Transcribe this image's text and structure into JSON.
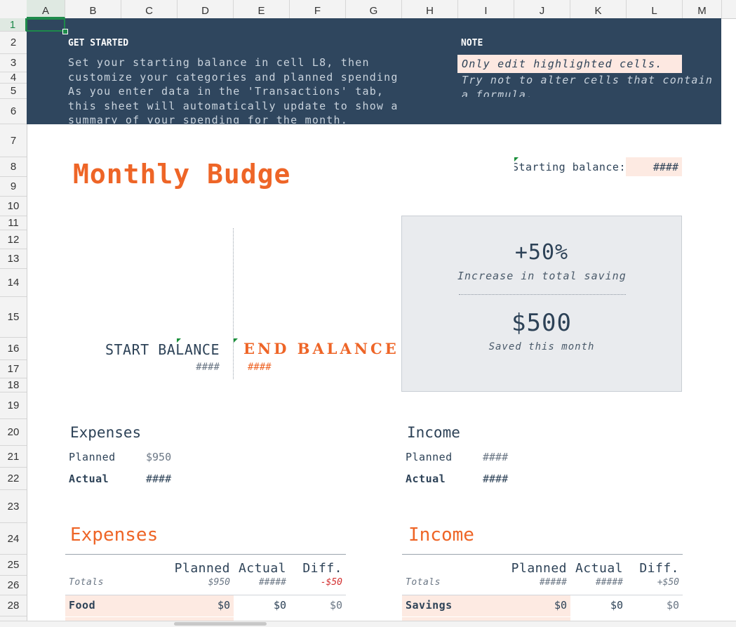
{
  "columns": [
    "A",
    "B",
    "C",
    "D",
    "E",
    "F",
    "G",
    "H",
    "I",
    "J",
    "K",
    "L",
    "M"
  ],
  "rows": [
    "1",
    "2",
    "3",
    "4",
    "5",
    "6",
    "7",
    "8",
    "9",
    "10",
    "11",
    "12",
    "13",
    "14",
    "15",
    "16",
    "17",
    "18",
    "19",
    "20",
    "21",
    "22",
    "23",
    "24",
    "25",
    "26",
    "28"
  ],
  "banner": {
    "get_started_title": "GET STARTED",
    "get_started_lines": [
      "Set your starting balance in cell L8, then",
      "customize your categories and planned spending",
      "As you enter data in the 'Transactions' tab,",
      "this sheet will automatically update to show a",
      "summary of your spending for the month."
    ],
    "note_title": "NOTE",
    "note_line1": "Only edit highlighted cells.",
    "note_line2": "Try not to alter cells that contain",
    "note_line3": "a formula."
  },
  "sheet_title": "Monthly Budget",
  "starting_balance_label": "Starting balance:",
  "starting_balance_value": "####",
  "start_balance_label": "START BALANCE",
  "start_balance_value": "####",
  "end_balance_label": "END BALANCE",
  "end_balance_value": "####",
  "stats": {
    "percent": "+50%",
    "percent_caption": "Increase in total savings",
    "saved": "$500",
    "saved_caption": "Saved this month"
  },
  "summary": {
    "expenses_title": "Expenses",
    "income_title": "Income",
    "planned_label": "Planned",
    "actual_label": "Actual",
    "expenses_planned": "$950",
    "expenses_actual": "####",
    "income_planned": "####",
    "income_actual": "####"
  },
  "expenses_table": {
    "title": "Expenses",
    "headers": [
      "Planned",
      "Actual",
      "Diff."
    ],
    "totals_label": "Totals",
    "totals": [
      "$950",
      "#####",
      "-$50"
    ],
    "rows": [
      {
        "name": "Food",
        "values": [
          "$0",
          "$0",
          "$0"
        ]
      }
    ]
  },
  "income_table": {
    "title": "Income",
    "headers": [
      "Planned",
      "Actual",
      "Diff."
    ],
    "totals_label": "Totals",
    "totals": [
      "#####",
      "#####",
      "+$50"
    ],
    "rows": [
      {
        "name": "Savings",
        "values": [
          "$0",
          "$0",
          "$0"
        ]
      }
    ]
  },
  "colors": {
    "banner": "#2f465e",
    "accent": "#ee6527",
    "highlight": "#fdeae2",
    "selection": "#1e8a4b"
  }
}
